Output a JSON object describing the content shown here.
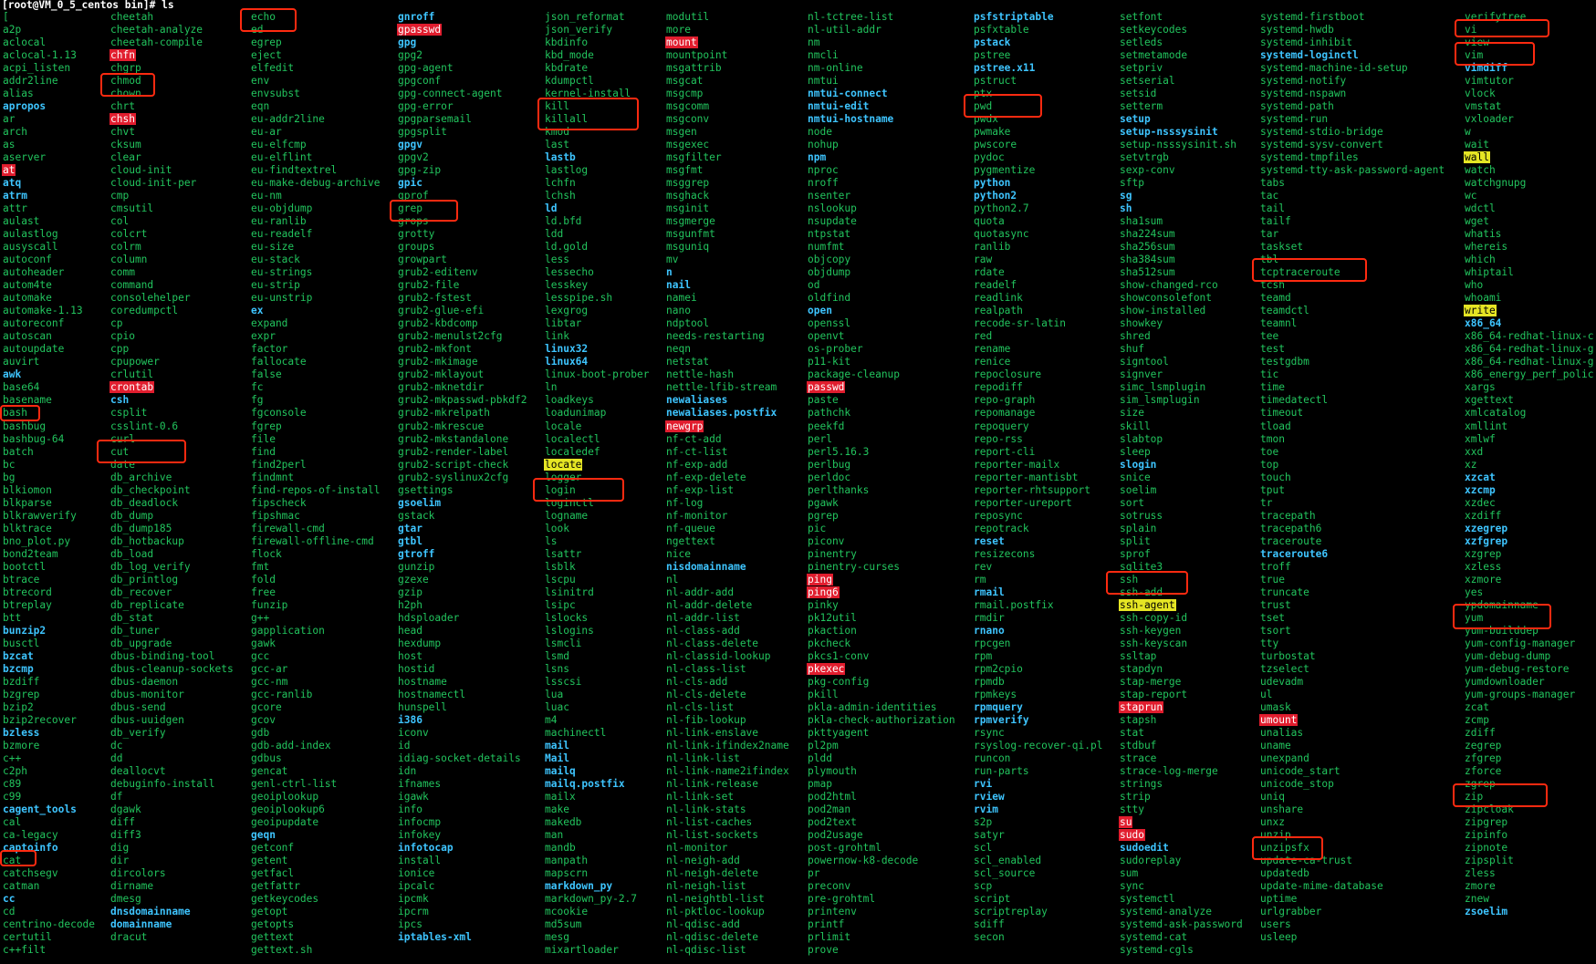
{
  "prompt": "[root@VM_0_5_centos bin]# ls",
  "colors": {
    "background": "#000000",
    "regular": "#22c55e",
    "bold": "#3ec5ff",
    "setuid_bg": "#e11d2e",
    "setgid_bg": "#e5e524",
    "highlight_box": "#ff2a10"
  },
  "columns": [
    [
      "[",
      "a2p",
      "aclocal",
      "aclocal-1.13",
      "acpi_listen",
      "addr2line",
      "alias",
      "apropos",
      "ar",
      "arch",
      "as",
      "aserver",
      "at",
      "atq",
      "atrm",
      "attr",
      "aulast",
      "aulastlog",
      "ausyscall",
      "autoconf",
      "autoheader",
      "autom4te",
      "automake",
      "automake-1.13",
      "autoreconf",
      "autoscan",
      "autoupdate",
      "auvirt",
      "awk",
      "base64",
      "basename",
      "bash",
      "bashbug",
      "bashbug-64",
      "batch",
      "bc",
      "bg",
      "blkiomon",
      "blkparse",
      "blkrawverify",
      "blktrace",
      "bno_plot.py",
      "bond2team",
      "bootctl",
      "btrace",
      "btrecord",
      "btreplay",
      "btt",
      "bunzip2",
      "busctl",
      "bzcat",
      "bzcmp",
      "bzdiff",
      "bzgrep",
      "bzip2",
      "bzip2recover",
      "bzless",
      "bzmore",
      "c++",
      "c2ph",
      "c89",
      "c99",
      "cagent_tools",
      "cal",
      "ca-legacy",
      "captoinfo",
      "cat",
      "catchsegv",
      "catman",
      "cc",
      "cd",
      "centrino-decode",
      "certutil",
      "c++filt"
    ],
    [
      "cheetah",
      "cheetah-analyze",
      "cheetah-compile",
      "chfn",
      "chgrp",
      "chmod",
      "chown",
      "chrt",
      "chsh",
      "chvt",
      "cksum",
      "clear",
      "cloud-init",
      "cloud-init-per",
      "cmp",
      "cmsutil",
      "col",
      "colcrt",
      "colrm",
      "column",
      "comm",
      "command",
      "consolehelper",
      "coredumpctl",
      "cp",
      "cpio",
      "cpp",
      "cpupower",
      "crlutil",
      "crontab",
      "csh",
      "csplit",
      "csslint-0.6",
      "curl",
      "cut",
      "date",
      "db_archive",
      "db_checkpoint",
      "db_deadlock",
      "db_dump",
      "db_dump185",
      "db_hotbackup",
      "db_load",
      "db_log_verify",
      "db_printlog",
      "db_recover",
      "db_replicate",
      "db_stat",
      "db_tuner",
      "db_upgrade",
      "dbus-binding-tool",
      "dbus-cleanup-sockets",
      "dbus-daemon",
      "dbus-monitor",
      "dbus-send",
      "dbus-uuidgen",
      "db_verify",
      "dc",
      "dd",
      "deallocvt",
      "debuginfo-install",
      "df",
      "dgawk",
      "diff",
      "diff3",
      "dig",
      "dir",
      "dircolors",
      "dirname",
      "dmesg",
      "dnsdomainname",
      "domainname",
      "dracut"
    ],
    [
      "echo",
      "ed",
      "egrep",
      "eject",
      "elfedit",
      "env",
      "envsubst",
      "eqn",
      "eu-addr2line",
      "eu-ar",
      "eu-elfcmp",
      "eu-elflint",
      "eu-findtextrel",
      "eu-make-debug-archive",
      "eu-nm",
      "eu-objdump",
      "eu-ranlib",
      "eu-readelf",
      "eu-size",
      "eu-stack",
      "eu-strings",
      "eu-strip",
      "eu-unstrip",
      "ex",
      "expand",
      "expr",
      "factor",
      "fallocate",
      "false",
      "fc",
      "fg",
      "fgconsole",
      "fgrep",
      "file",
      "find",
      "find2perl",
      "findmnt",
      "find-repos-of-install",
      "fipscheck",
      "fipshmac",
      "firewall-cmd",
      "firewall-offline-cmd",
      "flock",
      "fmt",
      "fold",
      "free",
      "funzip",
      "g++",
      "gapplication",
      "gawk",
      "gcc",
      "gcc-ar",
      "gcc-nm",
      "gcc-ranlib",
      "gcore",
      "gcov",
      "gdb",
      "gdb-add-index",
      "gdbus",
      "gencat",
      "genl-ctrl-list",
      "geoiplookup",
      "geoiplookup6",
      "geoipupdate",
      "geqn",
      "getconf",
      "getent",
      "getfacl",
      "getfattr",
      "getkeycodes",
      "getopt",
      "getopts",
      "gettext",
      "gettext.sh"
    ],
    [
      "gnroff",
      "gpasswd",
      "gpg",
      "gpg2",
      "gpg-agent",
      "gpgconf",
      "gpg-connect-agent",
      "gpg-error",
      "gpgparsemail",
      "gpgsplit",
      "gpgv",
      "gpgv2",
      "gpg-zip",
      "gpic",
      "gprof",
      "grep",
      "grops",
      "grotty",
      "groups",
      "growpart",
      "grub2-editenv",
      "grub2-file",
      "grub2-fstest",
      "grub2-glue-efi",
      "grub2-kbdcomp",
      "grub2-menulst2cfg",
      "grub2-mkfont",
      "grub2-mkimage",
      "grub2-mklayout",
      "grub2-mknetdir",
      "grub2-mkpasswd-pbkdf2",
      "grub2-mkrelpath",
      "grub2-mkrescue",
      "grub2-mkstandalone",
      "grub2-render-label",
      "grub2-script-check",
      "grub2-syslinux2cfg",
      "gsettings",
      "gsoelim",
      "gstack",
      "gtar",
      "gtbl",
      "gtroff",
      "gunzip",
      "gzexe",
      "gzip",
      "h2ph",
      "hdsploader",
      "head",
      "hexdump",
      "host",
      "hostid",
      "hostname",
      "hostnamectl",
      "hunspell",
      "i386",
      "iconv",
      "id",
      "idiag-socket-details",
      "idn",
      "ifnames",
      "igawk",
      "info",
      "infocmp",
      "infokey",
      "infotocap",
      "install",
      "ionice",
      "ipcalc",
      "ipcmk",
      "ipcrm",
      "ipcs",
      "iptables-xml"
    ],
    [
      "json_reformat",
      "json_verify",
      "kbdinfo",
      "kbd_mode",
      "kbdrate",
      "kdumpctl",
      "kernel-install",
      "kill",
      "killall",
      "kmod",
      "last",
      "lastb",
      "lastlog",
      "lchfn",
      "lchsh",
      "ld",
      "ld.bfd",
      "ldd",
      "ld.gold",
      "less",
      "lessecho",
      "lesskey",
      "lesspipe.sh",
      "lexgrog",
      "libtar",
      "link",
      "linux32",
      "linux64",
      "linux-boot-prober",
      "ln",
      "loadkeys",
      "loadunimap",
      "locale",
      "localectl",
      "localedef",
      "locate",
      "logger",
      "login",
      "loginctl",
      "logname",
      "look",
      "ls",
      "lsattr",
      "lsblk",
      "lscpu",
      "lsinitrd",
      "lsipc",
      "lslocks",
      "lslogins",
      "lsmcli",
      "lsmd",
      "lsns",
      "lsscsi",
      "lua",
      "luac",
      "m4",
      "machinectl",
      "mail",
      "Mail",
      "mailq",
      "mailq.postfix",
      "mailx",
      "make",
      "makedb",
      "man",
      "mandb",
      "manpath",
      "mapscrn",
      "markdown_py",
      "markdown_py-2.7",
      "mcookie",
      "md5sum",
      "mesg",
      "mixartloader"
    ],
    [
      "modutil",
      "more",
      "mount",
      "mountpoint",
      "msgattrib",
      "msgcat",
      "msgcmp",
      "msgcomm",
      "msgconv",
      "msgen",
      "msgexec",
      "msgfilter",
      "msgfmt",
      "msggrep",
      "msghack",
      "msginit",
      "msgmerge",
      "msgunfmt",
      "msguniq",
      "mv",
      "n",
      "nail",
      "namei",
      "nano",
      "ndptool",
      "needs-restarting",
      "neqn",
      "netstat",
      "nettle-hash",
      "nettle-lfib-stream",
      "newaliases",
      "newaliases.postfix",
      "newgrp",
      "nf-ct-add",
      "nf-ct-list",
      "nf-exp-add",
      "nf-exp-delete",
      "nf-exp-list",
      "nf-log",
      "nf-monitor",
      "nf-queue",
      "ngettext",
      "nice",
      "nisdomainname",
      "nl",
      "nl-addr-add",
      "nl-addr-delete",
      "nl-addr-list",
      "nl-class-add",
      "nl-class-delete",
      "nl-classid-lookup",
      "nl-class-list",
      "nl-cls-add",
      "nl-cls-delete",
      "nl-cls-list",
      "nl-fib-lookup",
      "nl-link-enslave",
      "nl-link-ifindex2name",
      "nl-link-list",
      "nl-link-name2ifindex",
      "nl-link-release",
      "nl-link-set",
      "nl-link-stats",
      "nl-list-caches",
      "nl-list-sockets",
      "nl-monitor",
      "nl-neigh-add",
      "nl-neigh-delete",
      "nl-neigh-list",
      "nl-neightbl-list",
      "nl-pktloc-lookup",
      "nl-qdisc-add",
      "nl-qdisc-delete",
      "nl-qdisc-list"
    ],
    [
      "nl-tctree-list",
      "nl-util-addr",
      "nm",
      "nmcli",
      "nm-online",
      "nmtui",
      "nmtui-connect",
      "nmtui-edit",
      "nmtui-hostname",
      "node",
      "nohup",
      "npm",
      "nproc",
      "nroff",
      "nsenter",
      "nslookup",
      "nsupdate",
      "ntpstat",
      "numfmt",
      "objcopy",
      "objdump",
      "od",
      "oldfind",
      "open",
      "openssl",
      "openvt",
      "os-prober",
      "p11-kit",
      "package-cleanup",
      "passwd",
      "paste",
      "pathchk",
      "peekfd",
      "perl",
      "perl5.16.3",
      "perlbug",
      "perldoc",
      "perlthanks",
      "pgawk",
      "pgrep",
      "pic",
      "piconv",
      "pinentry",
      "pinentry-curses",
      "ping",
      "ping6",
      "pinky",
      "pk12util",
      "pkaction",
      "pkcheck",
      "pkcs1-conv",
      "pkexec",
      "pkg-config",
      "pkill",
      "pkla-admin-identities",
      "pkla-check-authorization",
      "pkttyagent",
      "pl2pm",
      "pldd",
      "plymouth",
      "pmap",
      "pod2html",
      "pod2man",
      "pod2text",
      "pod2usage",
      "post-grohtml",
      "powernow-k8-decode",
      "pr",
      "preconv",
      "pre-grohtml",
      "printenv",
      "printf",
      "prlimit",
      "prove"
    ],
    [
      "psfstriptable",
      "psfxtable",
      "pstack",
      "pstree",
      "pstree.x11",
      "pstruct",
      "ptx",
      "pwd",
      "pwdx",
      "pwmake",
      "pwscore",
      "pydoc",
      "pygmentize",
      "python",
      "python2",
      "python2.7",
      "quota",
      "quotasync",
      "ranlib",
      "raw",
      "rdate",
      "readelf",
      "readlink",
      "realpath",
      "recode-sr-latin",
      "red",
      "rename",
      "renice",
      "repoclosure",
      "repodiff",
      "repo-graph",
      "repomanage",
      "repoquery",
      "repo-rss",
      "report-cli",
      "reporter-mailx",
      "reporter-mantisbt",
      "reporter-rhtsupport",
      "reporter-ureport",
      "reposync",
      "repotrack",
      "reset",
      "resizecons",
      "rev",
      "rm",
      "rmail",
      "rmail.postfix",
      "rmdir",
      "rnano",
      "rpcgen",
      "rpm",
      "rpm2cpio",
      "rpmdb",
      "rpmkeys",
      "rpmquery",
      "rpmverify",
      "rsync",
      "rsyslog-recover-qi.pl",
      "runcon",
      "run-parts",
      "rvi",
      "rview",
      "rvim",
      "s2p",
      "satyr",
      "scl",
      "scl_enabled",
      "scl_source",
      "scp",
      "script",
      "scriptreplay",
      "sdiff",
      "secon"
    ],
    [
      "setfont",
      "setkeycodes",
      "setleds",
      "setmetamode",
      "setpriv",
      "setserial",
      "setsid",
      "setterm",
      "setup",
      "setup-nsssysinit",
      "setup-nsssysinit.sh",
      "setvtrgb",
      "sexp-conv",
      "sftp",
      "sg",
      "sh",
      "sha1sum",
      "sha224sum",
      "sha256sum",
      "sha384sum",
      "sha512sum",
      "show-changed-rco",
      "showconsolefont",
      "show-installed",
      "showkey",
      "shred",
      "shuf",
      "signtool",
      "signver",
      "simc_lsmplugin",
      "sim_lsmplugin",
      "size",
      "skill",
      "slabtop",
      "sleep",
      "slogin",
      "snice",
      "soelim",
      "sort",
      "sotruss",
      "splain",
      "split",
      "sprof",
      "sqlite3",
      "ssh",
      "ssh-add",
      "ssh-agent",
      "ssh-copy-id",
      "ssh-keygen",
      "ssh-keyscan",
      "ssltap",
      "stapdyn",
      "stap-merge",
      "stap-report",
      "staprun",
      "stapsh",
      "stat",
      "stdbuf",
      "strace",
      "strace-log-merge",
      "strings",
      "strip",
      "stty",
      "su",
      "sudo",
      "sudoedit",
      "sudoreplay",
      "sum",
      "sync",
      "systemctl",
      "systemd-analyze",
      "systemd-ask-password",
      "systemd-cat",
      "systemd-cgls"
    ],
    [
      "systemd-firstboot",
      "systemd-hwdb",
      "systemd-inhibit",
      "systemd-loginctl",
      "systemd-machine-id-setup",
      "systemd-notify",
      "systemd-nspawn",
      "systemd-path",
      "systemd-run",
      "systemd-stdio-bridge",
      "systemd-sysv-convert",
      "systemd-tmpfiles",
      "systemd-tty-ask-password-agent",
      "tabs",
      "tac",
      "tail",
      "tailf",
      "tar",
      "taskset",
      "tbl",
      "tcptraceroute",
      "tcsh",
      "teamd",
      "teamdctl",
      "teamnl",
      "tee",
      "test",
      "testgdbm",
      "tic",
      "time",
      "timedatectl",
      "timeout",
      "tload",
      "tmon",
      "toe",
      "top",
      "touch",
      "tput",
      "tr",
      "tracepath",
      "tracepath6",
      "traceroute",
      "traceroute6",
      "troff",
      "true",
      "truncate",
      "trust",
      "tset",
      "tsort",
      "tty",
      "turbostat",
      "tzselect",
      "udevadm",
      "ul",
      "umask",
      "umount",
      "unalias",
      "uname",
      "unexpand",
      "unicode_start",
      "unicode_stop",
      "uniq",
      "unshare",
      "unxz",
      "unzip",
      "unzipsfx",
      "update-ca-trust",
      "updatedb",
      "update-mime-database",
      "uptime",
      "urlgrabber",
      "users",
      "usleep"
    ],
    [
      "verifytree",
      "vi",
      "view",
      "vim",
      "vimdiff",
      "vimtutor",
      "vlock",
      "vmstat",
      "vxloader",
      "w",
      "wait",
      "wall",
      "watch",
      "watchgnupg",
      "wc",
      "wdctl",
      "wget",
      "whatis",
      "whereis",
      "which",
      "whiptail",
      "who",
      "whoami",
      "write",
      "x86_64",
      "x86_64-redhat-linux-c",
      "x86_64-redhat-linux-g",
      "x86_64-redhat-linux-g",
      "x86_energy_perf_polic",
      "xargs",
      "xgettext",
      "xmlcatalog",
      "xmllint",
      "xmlwf",
      "xxd",
      "xz",
      "xzcat",
      "xzcmp",
      "xzdec",
      "xzdiff",
      "xzegrep",
      "xzfgrep",
      "xzgrep",
      "xzless",
      "xzmore",
      "yes",
      "ypdomainname",
      "yum",
      "yum-builddep",
      "yum-config-manager",
      "yum-debug-dump",
      "yum-debug-restore",
      "yumdownloader",
      "yum-groups-manager",
      "zcat",
      "zcmp",
      "zdiff",
      "zegrep",
      "zfgrep",
      "zforce",
      "zgrep",
      "zip",
      "zipcloak",
      "zipgrep",
      "zipinfo",
      "zipnote",
      "zipsplit",
      "zless",
      "zmore",
      "znew",
      "zsoelim"
    ]
  ],
  "bold_commands": [
    "apropos",
    "atq",
    "atrm",
    "awk",
    "bunzip2",
    "bzcat",
    "bzcmp",
    "bzless",
    "cagent_tools",
    "captoinfo",
    "cc",
    "csh",
    "dnsdomainname",
    "domainname",
    "ex",
    "geqn",
    "gnroff",
    "gpg",
    "gpgv",
    "gpic",
    "gsoelim",
    "gtar",
    "gtbl",
    "gtroff",
    "i386",
    "infotocap",
    "iptables-xml",
    "lastb",
    "ld",
    "linux32",
    "linux64",
    "mail",
    "Mail",
    "mailq",
    "mailq.postfix",
    "markdown_py",
    "n",
    "nail",
    "newaliases",
    "newaliases.postfix",
    "nisdomainname",
    "nmtui-connect",
    "nmtui-edit",
    "nmtui-hostname",
    "npm",
    "open",
    "psfstriptable",
    "pstack",
    "pstree.x11",
    "python",
    "python2",
    "reset",
    "rmail",
    "rnano",
    "rpmquery",
    "rpmverify",
    "rvi",
    "rview",
    "rvim",
    "setup",
    "setup-nsssysinit",
    "sg",
    "sh",
    "slogin",
    "sudoedit",
    "systemd-loginctl",
    "traceroute6",
    "vimdiff",
    "x86_64",
    "xzcat",
    "xzcmp",
    "xzegrep",
    "xzfgrep",
    "zsoelim"
  ],
  "setuid_commands": [
    "at",
    "chfn",
    "chsh",
    "crontab",
    "gpasswd",
    "mount",
    "newgrp",
    "passwd",
    "ping",
    "ping6",
    "pkexec",
    "staprun",
    "su",
    "sudo",
    "umount"
  ],
  "setgid_commands": [
    "locate",
    "ssh-agent",
    "wall",
    "write"
  ],
  "highlighted_commands": [
    "echo",
    "chmod",
    "grep",
    "kill",
    "killall",
    "login",
    "pwd",
    "ssh",
    "tcptraceroute",
    "unzip",
    "bash",
    "curl",
    "cat",
    "vi",
    "vim",
    "yum",
    "zip"
  ]
}
